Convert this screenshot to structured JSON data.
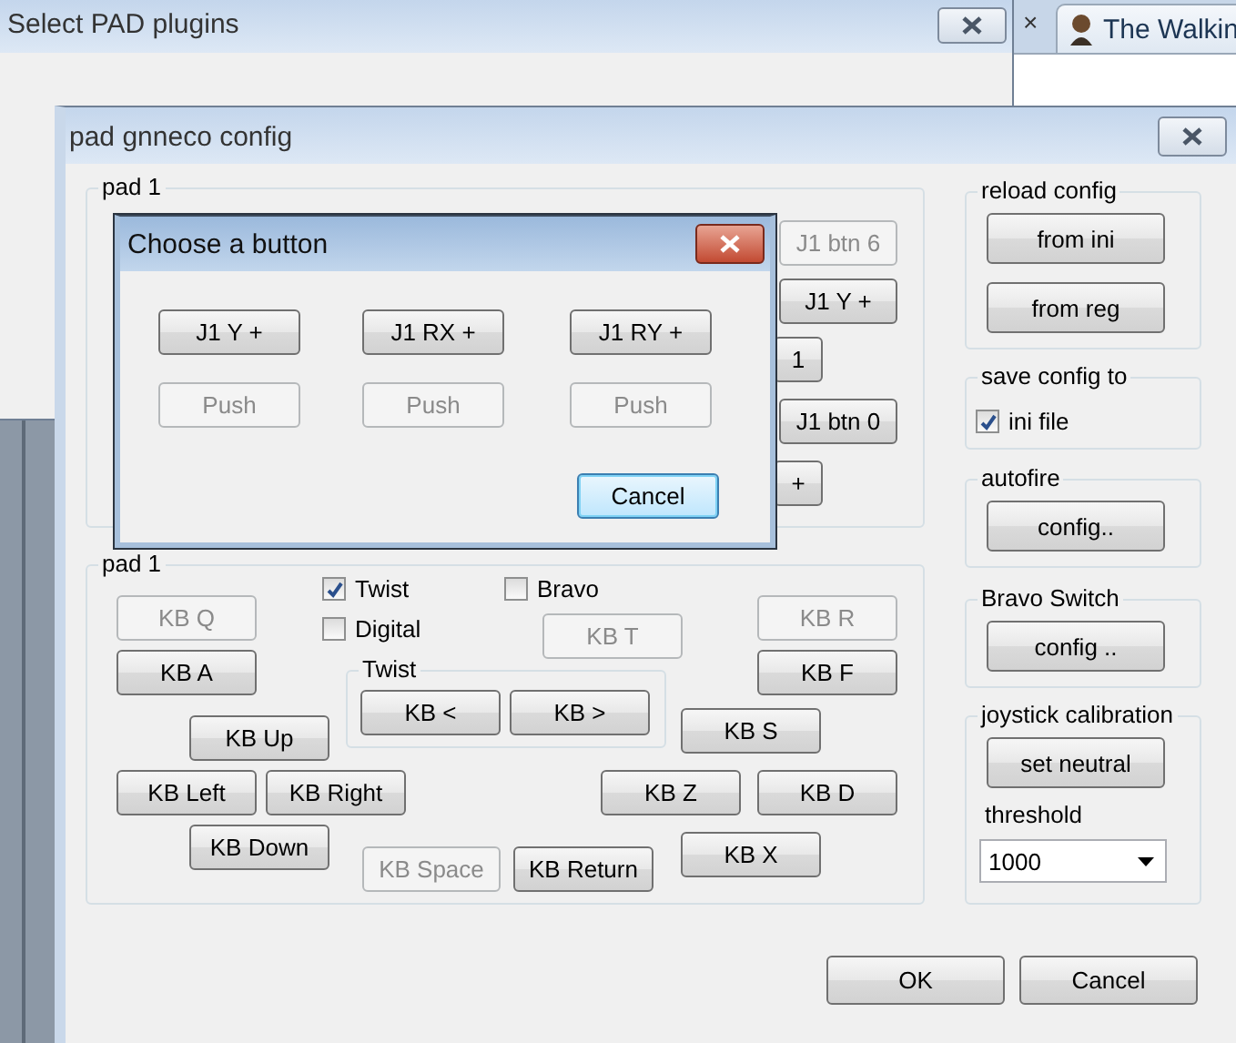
{
  "background_window": {
    "title": "Select PAD plugins"
  },
  "browser": {
    "tab_close": "×",
    "tab_title": "The Walkin"
  },
  "config_window": {
    "title": "pad gnneco config",
    "pad_groups": [
      {
        "title": "pad 1",
        "buttons": [
          {
            "label": "J1 btn 6",
            "disabled": true
          },
          {
            "label": "J1 Y +",
            "disabled": false
          },
          {
            "label": "1",
            "disabled": false
          },
          {
            "label": "J1 btn 0",
            "disabled": false
          },
          {
            "label": "+",
            "disabled": false
          }
        ]
      },
      {
        "title": "pad 1",
        "checkboxes": [
          {
            "label": "Twist",
            "checked": true
          },
          {
            "label": "Digital",
            "checked": false
          },
          {
            "label": "Bravo",
            "checked": false
          }
        ],
        "subgroup": {
          "title": "Twist",
          "buttons": [
            {
              "label": "KB <",
              "disabled": false
            },
            {
              "label": "KB >",
              "disabled": false
            }
          ]
        },
        "buttons": [
          {
            "label": "KB Q",
            "disabled": true
          },
          {
            "label": "KB A",
            "disabled": false
          },
          {
            "label": "KB T",
            "disabled": true
          },
          {
            "label": "KB R",
            "disabled": true
          },
          {
            "label": "KB F",
            "disabled": false
          },
          {
            "label": "KB Up",
            "disabled": false
          },
          {
            "label": "KB S",
            "disabled": false
          },
          {
            "label": "KB Left",
            "disabled": false
          },
          {
            "label": "KB Right",
            "disabled": false
          },
          {
            "label": "KB Z",
            "disabled": false
          },
          {
            "label": "KB D",
            "disabled": false
          },
          {
            "label": "KB Down",
            "disabled": false
          },
          {
            "label": "KB Space",
            "disabled": true
          },
          {
            "label": "KB Return",
            "disabled": false
          },
          {
            "label": "KB X",
            "disabled": false
          }
        ]
      }
    ],
    "reload_config": {
      "title": "reload config",
      "buttons": [
        "from ini",
        "from reg"
      ]
    },
    "save_config": {
      "title": "save config to",
      "checkbox": {
        "label": "ini file",
        "checked": true
      }
    },
    "autofire": {
      "title": "autofire",
      "button": "config.."
    },
    "bravo_switch": {
      "title": "Bravo Switch",
      "button": "config .."
    },
    "calibration": {
      "title": "joystick calibration",
      "button": "set neutral",
      "threshold_label": "threshold",
      "threshold_value": "1000"
    },
    "buttons": [
      "OK",
      "Cancel"
    ]
  },
  "choose_dialog": {
    "title": "Choose a button",
    "buttons": [
      {
        "label": "J1 Y +",
        "disabled": false
      },
      {
        "label": "J1 RX +",
        "disabled": false
      },
      {
        "label": "J1 RY +",
        "disabled": false
      },
      {
        "label": "Push",
        "disabled": true
      },
      {
        "label": "Push",
        "disabled": true
      },
      {
        "label": "Push",
        "disabled": true
      }
    ],
    "cancel": "Cancel"
  }
}
